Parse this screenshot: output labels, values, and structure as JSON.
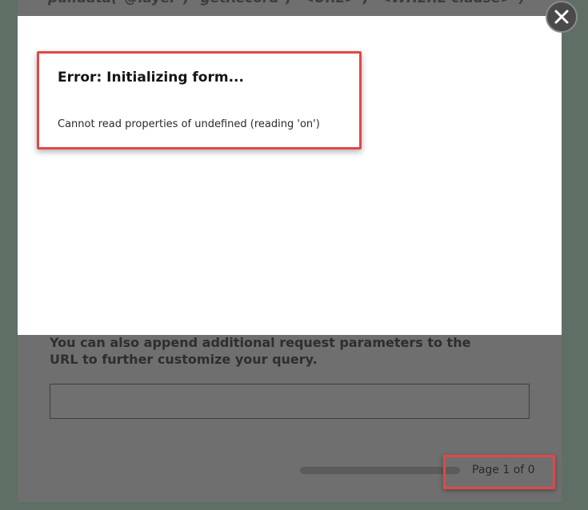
{
  "background": {
    "code_line": "pulldata(\"@layer\", \"getRecord\", \"<URL>\", \"<WHERE clause>\")",
    "append_text": "You can also append additional request parameters to the URL to further customize your query.",
    "input_value": "",
    "pager_text": "Page 1 of 0"
  },
  "modal": {
    "error_title": "Error: Initializing form...",
    "error_message": "Cannot read properties of undefined (reading 'on')",
    "close_icon": "close-icon"
  },
  "colors": {
    "highlight": "#e04848",
    "overlay": "#6f6f6f",
    "modal_bg": "#ffffff"
  }
}
